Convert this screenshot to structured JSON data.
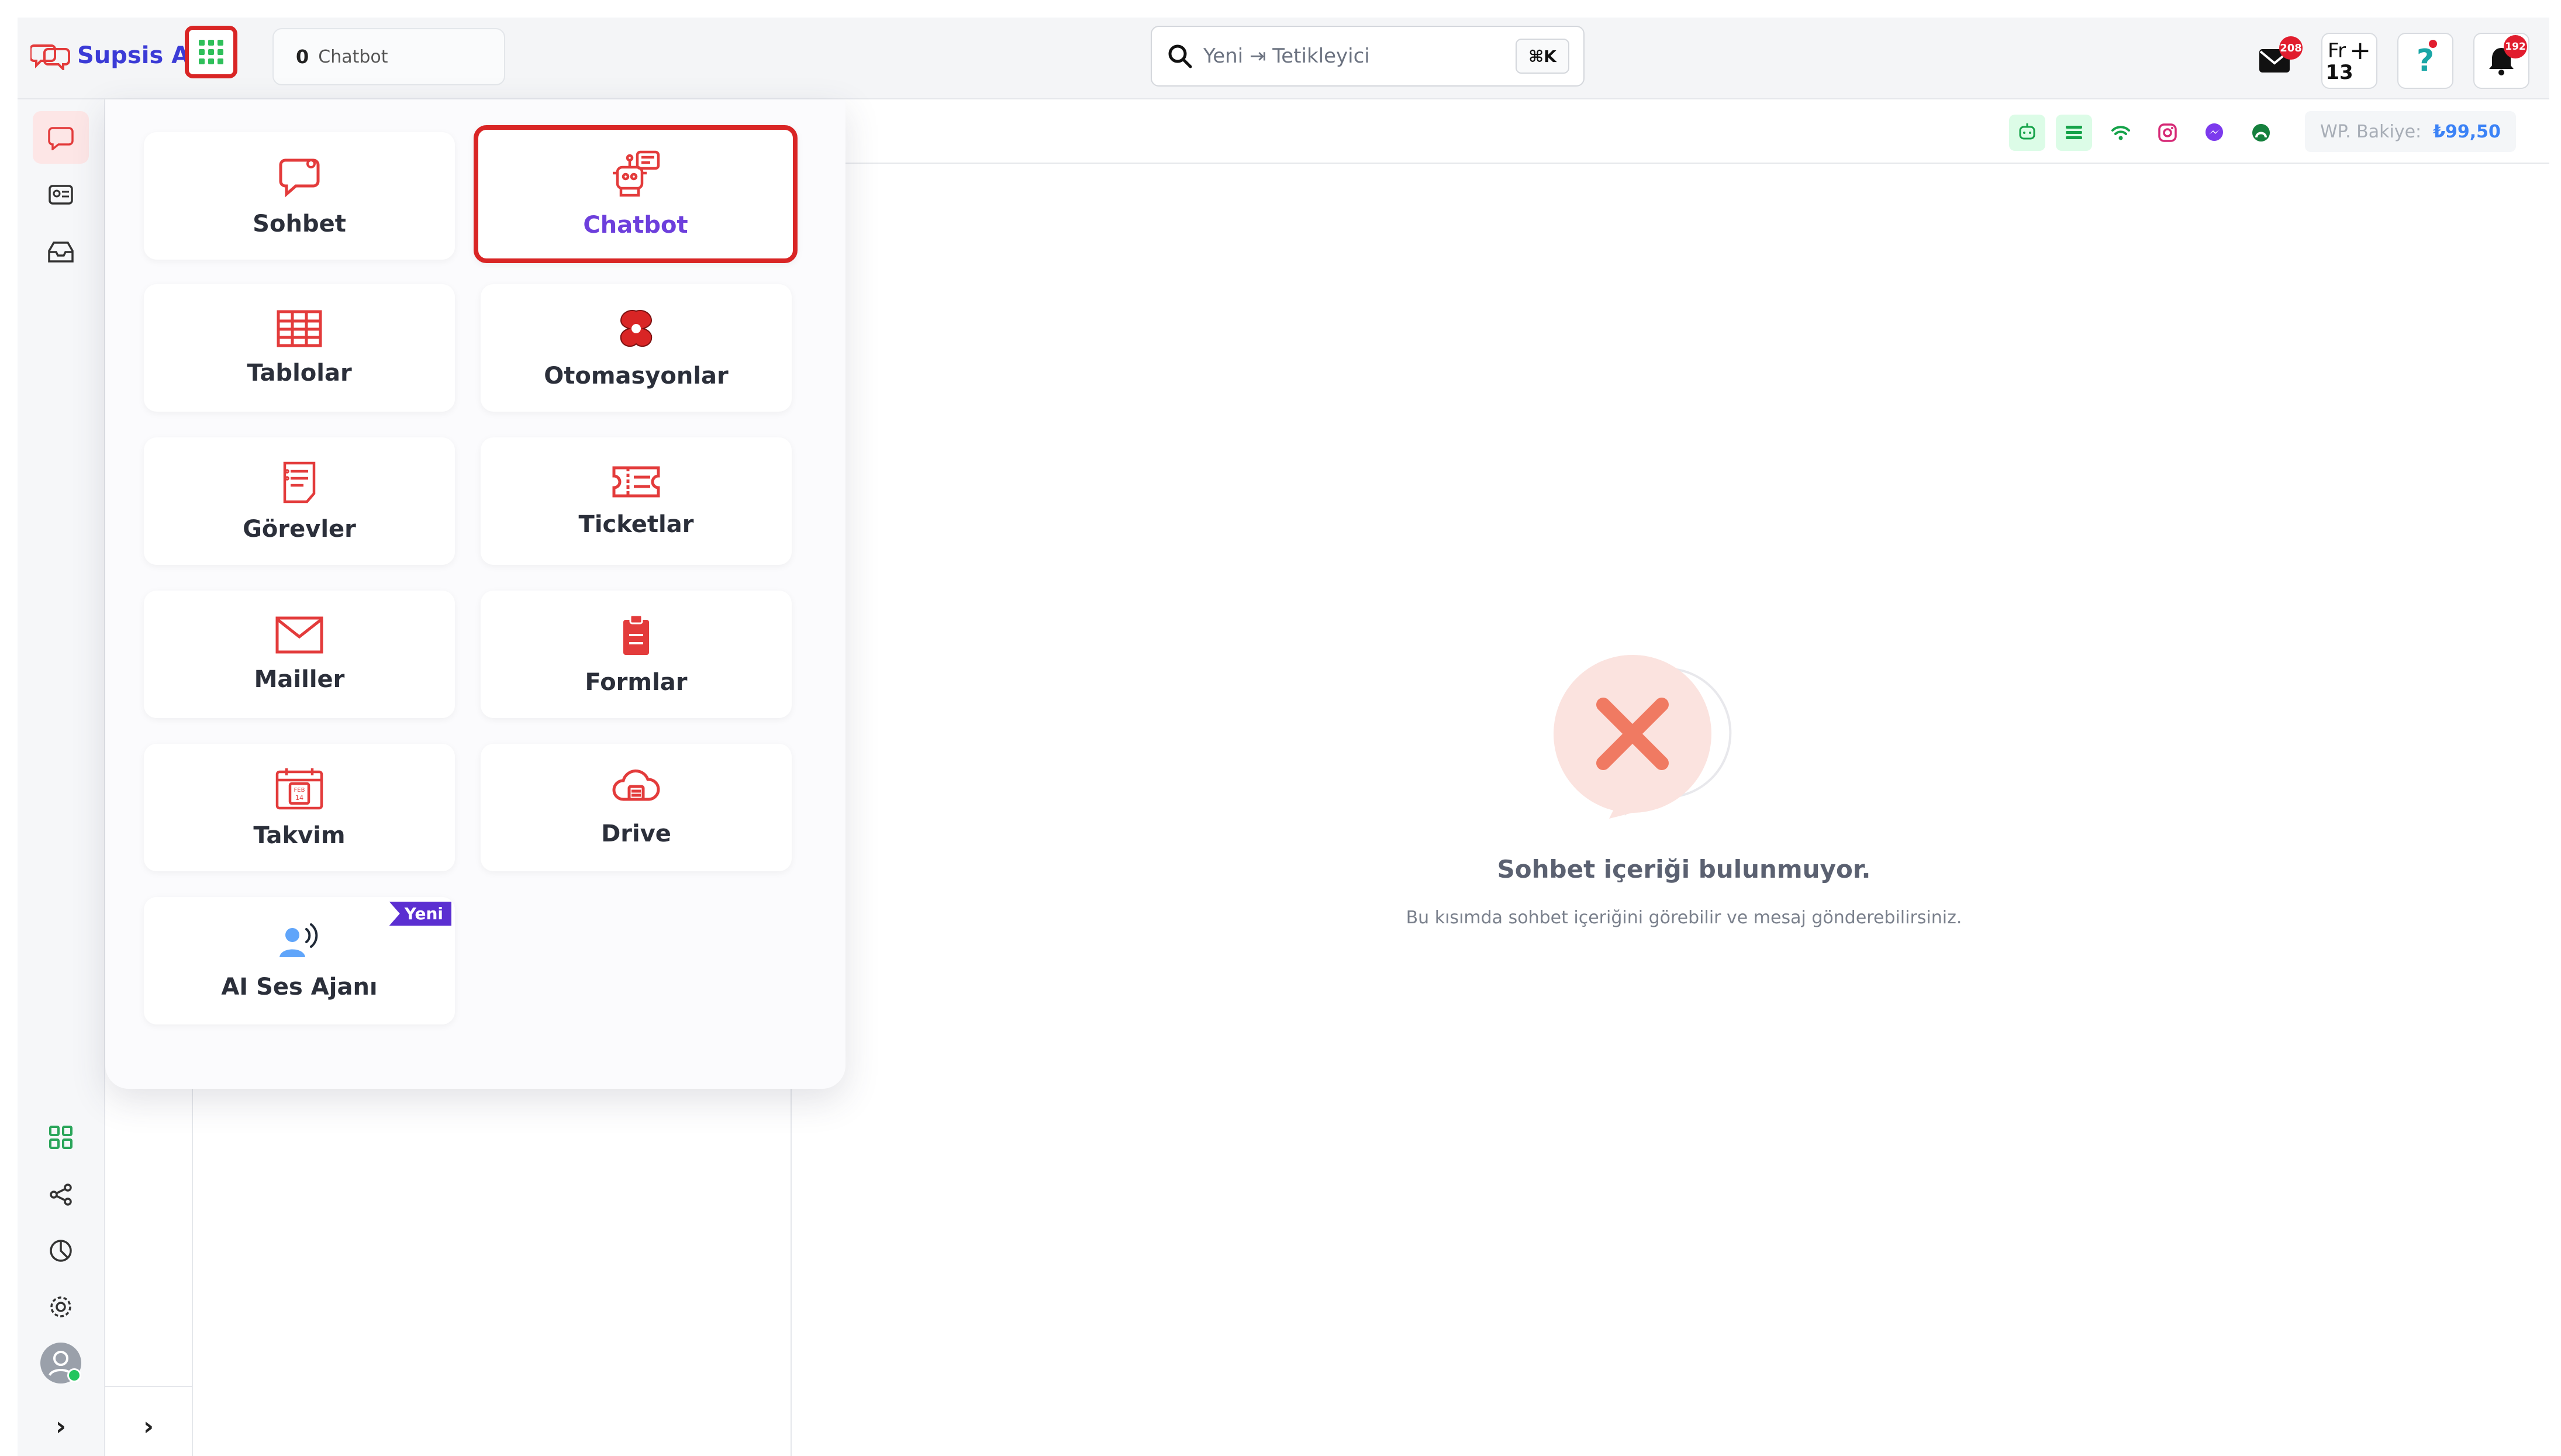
{
  "header": {
    "logo_text": "Supsis Ai",
    "chatbot_count": "0",
    "chatbot_label": "Chatbot",
    "search_placeholder": "Yeni ⇥ Tetikleyici",
    "search_shortcut": "⌘K",
    "mail_badge": "208",
    "calendar_day_short": "Fr",
    "calendar_day_num": "13",
    "notification_badge": "192"
  },
  "channels": {
    "wp_balance_label": "WP. Bakiye:",
    "wp_balance_value": "₺99,50"
  },
  "apps_menu": {
    "items": [
      {
        "label": "Sohbet",
        "icon": "chat-bubble-icon"
      },
      {
        "label": "Chatbot",
        "icon": "robot-icon",
        "selected": true
      },
      {
        "label": "Tablolar",
        "icon": "table-grid-icon"
      },
      {
        "label": "Otomasyonlar",
        "icon": "automation-icon"
      },
      {
        "label": "Görevler",
        "icon": "task-list-icon"
      },
      {
        "label": "Ticketlar",
        "icon": "ticket-icon"
      },
      {
        "label": "Mailler",
        "icon": "envelope-icon"
      },
      {
        "label": "Formlar",
        "icon": "clipboard-icon"
      },
      {
        "label": "Takvim",
        "icon": "calendar-icon"
      },
      {
        "label": "Drive",
        "icon": "cloud-drive-icon"
      },
      {
        "label": "AI Ses Ajanı",
        "icon": "voice-agent-icon",
        "tag": "Yeni"
      }
    ]
  },
  "empty_state": {
    "title": "Sohbet içeriği bulunmuyor.",
    "description": "Bu kısımda sohbet içeriğini görebilir ve mesaj gönderebilirsiniz."
  },
  "colors": {
    "accent_red": "#d92525",
    "brand_purple": "#6d3fdc",
    "balance_blue": "#3b82f6"
  }
}
